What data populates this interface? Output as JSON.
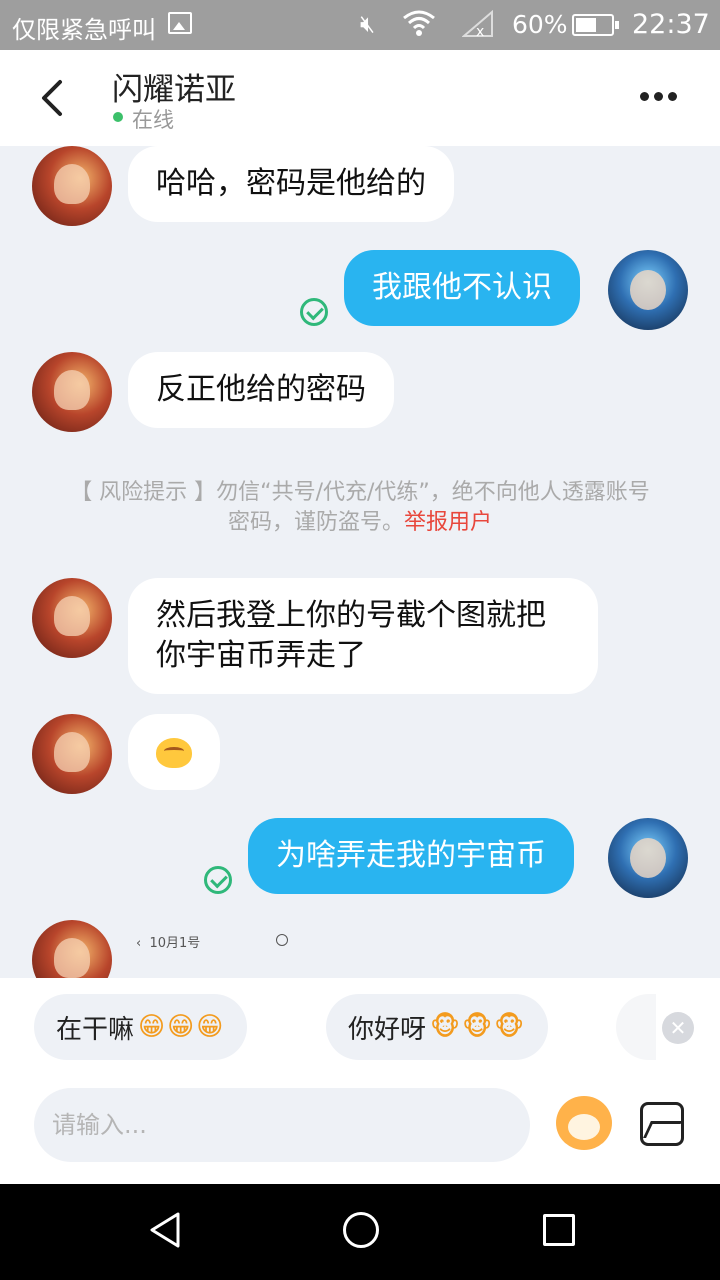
{
  "status_bar": {
    "carrier_text": "仅限紧急呼叫",
    "battery_percent": "60%",
    "time": "22:37",
    "icons": [
      "image-icon",
      "mute-icon",
      "wifi-icon",
      "no-signal-icon",
      "battery-icon"
    ]
  },
  "header": {
    "title": "闪耀诺亚",
    "status": "在线"
  },
  "messages": [
    {
      "side": "in",
      "text": "哈哈，密码是他给的"
    },
    {
      "side": "out",
      "text": "我跟他不认识",
      "read": true
    },
    {
      "side": "in",
      "text": "反正他给的密码"
    },
    {
      "side": "in",
      "text": "然后我登上你的号截个图就把你宇宙币弄走了"
    },
    {
      "side": "in",
      "emoji": "smiling-face-emoji"
    },
    {
      "side": "out",
      "text": "为啥弄走我的宇宙币",
      "read": true
    },
    {
      "side": "in",
      "partial_note": "10月1号"
    }
  ],
  "risk_notice": {
    "text": "【 风险提示 】勿信“共号/代充/代练”，绝不向他人透露账号密码，谨防盗号。",
    "link": "举报用户"
  },
  "quick_replies": [
    {
      "label": "在干嘛",
      "sticker": "grinning-tiger-stickers"
    },
    {
      "label": "你好呀",
      "sticker": "monkey-face-stickers"
    }
  ],
  "input": {
    "placeholder": "请输入..."
  },
  "nav_icons": [
    "back-triangle-icon",
    "home-circle-icon",
    "recent-apps-square-icon"
  ]
}
